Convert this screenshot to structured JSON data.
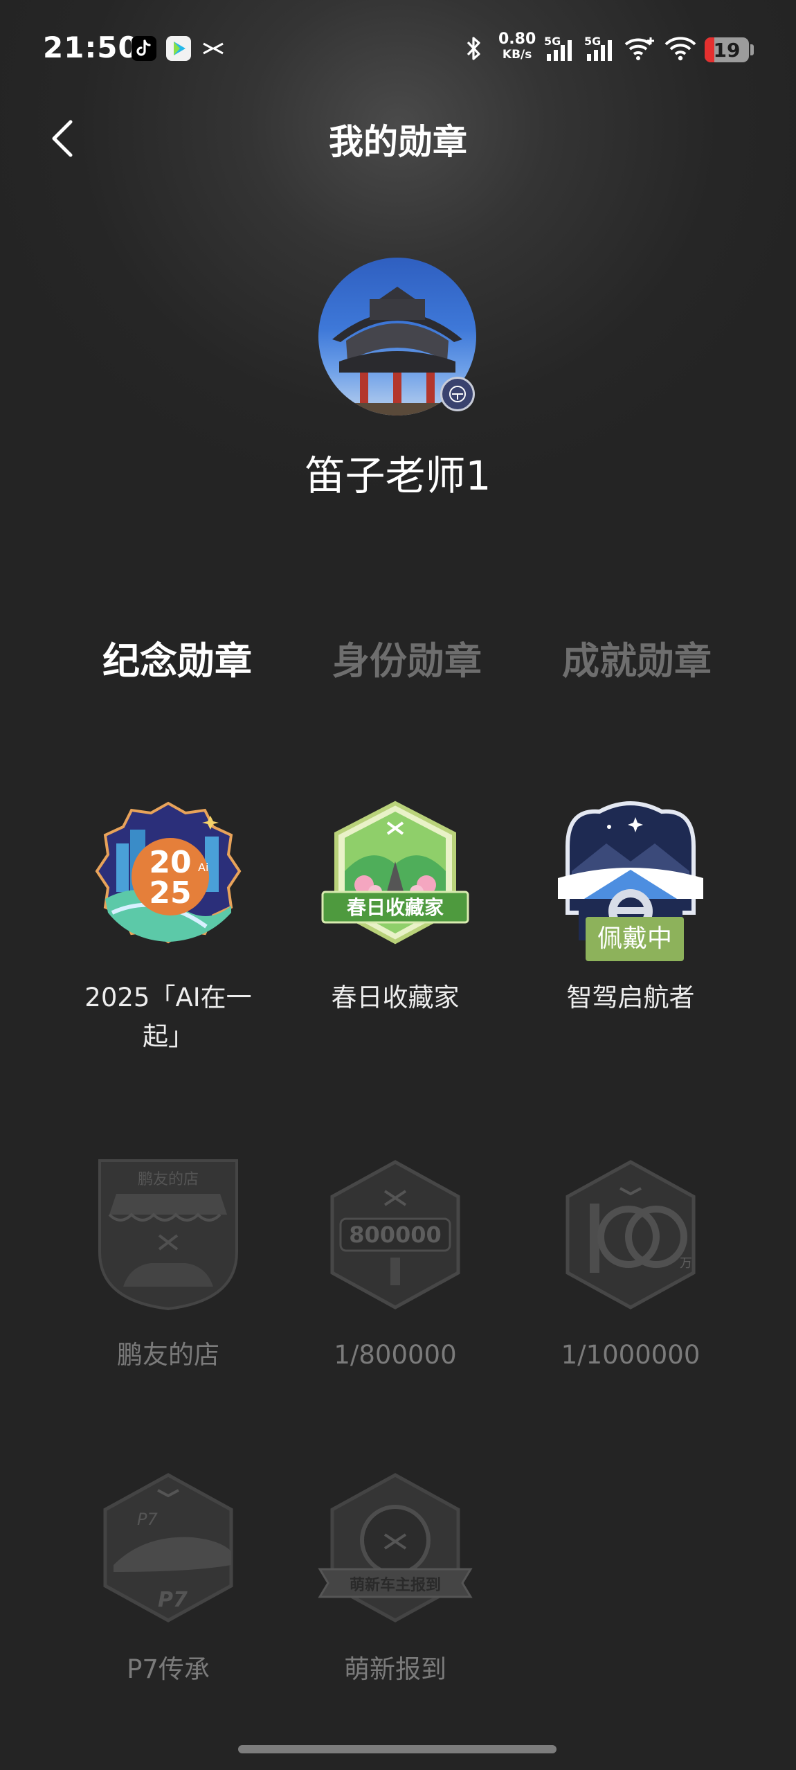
{
  "status_bar": {
    "time": "21:50",
    "speed_value": "0.80",
    "speed_unit": "KB/s",
    "net1": "5G",
    "net2": "5G",
    "battery": "19"
  },
  "header": {
    "title": "我的勋章"
  },
  "profile": {
    "username": "笛子老师1"
  },
  "tabs": [
    {
      "label": "纪念勋章",
      "active": true
    },
    {
      "label": "身份勋章",
      "active": false
    },
    {
      "label": "成就勋章",
      "active": false
    }
  ],
  "badges": [
    {
      "label": "2025「AI在一\n起」",
      "earned": true,
      "art_text": "2025"
    },
    {
      "label": "春日收藏家",
      "earned": true,
      "art_text": "春日收藏家"
    },
    {
      "label": "智驾启航者",
      "earned": true,
      "wearing": "佩戴中"
    },
    {
      "label": "鹏友的店",
      "earned": false,
      "art_text": "鹏友的店"
    },
    {
      "label": "1/800000",
      "earned": false,
      "art_text": "800000"
    },
    {
      "label": "1/1000000",
      "earned": false,
      "art_text": "万"
    },
    {
      "label": "P7传承",
      "earned": false,
      "art_text": "P7"
    },
    {
      "label": "萌新报到",
      "earned": false,
      "art_text": "萌新车主报到"
    }
  ],
  "colors": {
    "background": "#242424",
    "active_tab": "#ffffff",
    "inactive_tab": "#6e6e6e",
    "wearing_tag": "#8db25b"
  }
}
